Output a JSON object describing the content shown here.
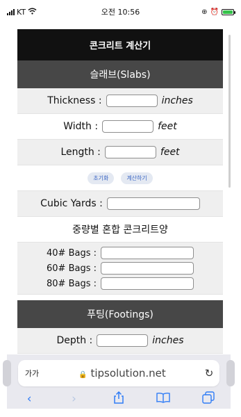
{
  "status_bar": {
    "carrier": "KT",
    "time": "오전 10:56"
  },
  "page": {
    "title": "콘크리트 계산기",
    "slabs": {
      "heading": "슬래브(Slabs)",
      "thickness_label": "Thickness :",
      "thickness_unit": "inches",
      "width_label": "Width :",
      "width_unit": "feet",
      "length_label": "Length :",
      "length_unit": "feet",
      "reset_label": "초기화",
      "calc_label": "계산하기",
      "cubic_label": "Cubic Yards :",
      "mix_heading": "중량별 혼합 콘크리트양",
      "bags": [
        {
          "label": "40# Bags :"
        },
        {
          "label": "60# Bags :"
        },
        {
          "label": "80# Bags :"
        }
      ]
    },
    "footings": {
      "heading": "푸팅(Footings)",
      "depth_label": "Depth :",
      "depth_unit": "inches"
    }
  },
  "browser": {
    "text_size": "가가",
    "url": "tipsolution.net"
  },
  "icons": {
    "back": "chevron-left-icon",
    "forward": "chevron-right-icon",
    "share": "share-icon",
    "bookmarks": "book-icon",
    "tabs": "tabs-icon"
  },
  "colors": {
    "title_bg": "#111111",
    "section_bg": "#474747",
    "accent": "#2f7cf6",
    "battery": "#35c24a"
  }
}
